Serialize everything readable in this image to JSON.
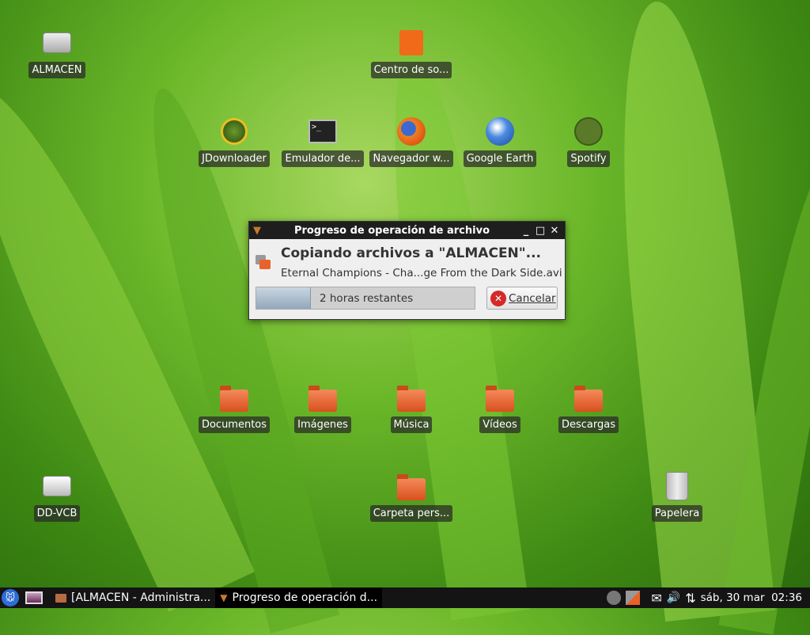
{
  "desktop": {
    "icons": [
      {
        "label": "ALMACEN",
        "icon": "hard-drive-icon"
      },
      {
        "label": "Centro de so...",
        "icon": "software-center-icon"
      },
      {
        "label": "JDownloader",
        "icon": "jdownloader-icon"
      },
      {
        "label": "Emulador de...",
        "icon": "terminal-icon"
      },
      {
        "label": "Navegador w...",
        "icon": "firefox-icon"
      },
      {
        "label": "Google Earth",
        "icon": "google-earth-icon"
      },
      {
        "label": "Spotify",
        "icon": "spotify-icon"
      },
      {
        "label": "Documentos",
        "icon": "folder-icon"
      },
      {
        "label": "Imágenes",
        "icon": "folder-icon"
      },
      {
        "label": "Música",
        "icon": "folder-icon"
      },
      {
        "label": "Vídeos",
        "icon": "folder-icon"
      },
      {
        "label": "Descargas",
        "icon": "folder-icon"
      },
      {
        "label": "DD-VCB",
        "icon": "usb-drive-icon"
      },
      {
        "label": "Carpeta pers...",
        "icon": "home-folder-icon"
      },
      {
        "label": "Papelera",
        "icon": "trash-icon"
      }
    ]
  },
  "dialog": {
    "title": "Progreso de operación de archivo",
    "heading": "Copiando archivos a \"ALMACEN\"...",
    "file": "Eternal Champions - Cha...ge From the Dark Side.avi",
    "progress_percent": 25,
    "progress_text": "2 horas restantes",
    "cancel_label": "Cancelar",
    "minimize": "_",
    "maximize": "□",
    "close": "✕"
  },
  "taskbar": {
    "tasks": [
      {
        "label": "[ALMACEN - Administra..."
      },
      {
        "label": "Progreso de operación d..."
      }
    ],
    "clock": "sáb, 30 mar  02:36"
  }
}
